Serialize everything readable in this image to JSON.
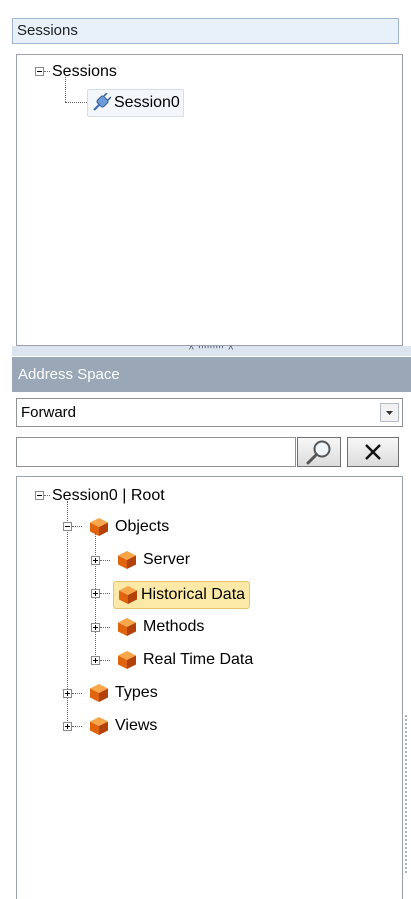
{
  "sessions": {
    "header": "Sessions",
    "tree": {
      "root": "Sessions",
      "child": "Session0"
    }
  },
  "splitter": {
    "grip": "^ ''''''''' ^"
  },
  "address_space": {
    "header": "Address Space",
    "dropdown_value": "Forward",
    "search_value": "",
    "tree": {
      "root": "Session0 | Root",
      "objects": "Objects",
      "server": "Server",
      "historical_data": "Historical Data",
      "methods": "Methods",
      "real_time_data": "Real Time Data",
      "types": "Types",
      "views": "Views"
    }
  },
  "icons": {
    "node_icon": "orange-cube-icon",
    "session_icon": "session-plug-icon",
    "search": "magnifier-icon",
    "clear": "close-x-icon",
    "dropdown": "chevron-down-icon"
  },
  "colors": {
    "selection": "#fce9a7",
    "header_bg": "#99a7b7",
    "cube": "#e8650f"
  }
}
